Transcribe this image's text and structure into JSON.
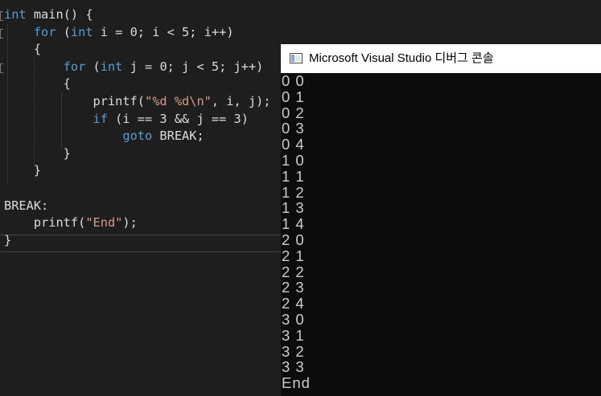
{
  "editor": {
    "lines": [
      {
        "parts": [
          {
            "t": "int",
            "c": "kw"
          },
          {
            "t": " main() {",
            "c": ""
          }
        ]
      },
      {
        "parts": [
          {
            "t": "    ",
            "c": ""
          },
          {
            "t": "for",
            "c": "kw"
          },
          {
            "t": " (",
            "c": ""
          },
          {
            "t": "int",
            "c": "kw"
          },
          {
            "t": " i = 0; i < 5; i++)",
            "c": ""
          }
        ]
      },
      {
        "parts": [
          {
            "t": "    {",
            "c": ""
          }
        ]
      },
      {
        "parts": [
          {
            "t": "        ",
            "c": ""
          },
          {
            "t": "for",
            "c": "kw"
          },
          {
            "t": " (",
            "c": ""
          },
          {
            "t": "int",
            "c": "kw"
          },
          {
            "t": " j = 0; j < 5; j++)",
            "c": ""
          }
        ]
      },
      {
        "parts": [
          {
            "t": "        {",
            "c": ""
          }
        ]
      },
      {
        "parts": [
          {
            "t": "            printf(",
            "c": ""
          },
          {
            "t": "\"%d %d\\n\"",
            "c": "str"
          },
          {
            "t": ", i, j);",
            "c": ""
          }
        ]
      },
      {
        "parts": [
          {
            "t": "            ",
            "c": ""
          },
          {
            "t": "if",
            "c": "kw"
          },
          {
            "t": " (i == 3 && j == 3)",
            "c": ""
          }
        ]
      },
      {
        "parts": [
          {
            "t": "                ",
            "c": ""
          },
          {
            "t": "goto",
            "c": "kw"
          },
          {
            "t": " BREAK;",
            "c": ""
          }
        ]
      },
      {
        "parts": [
          {
            "t": "        }",
            "c": ""
          }
        ]
      },
      {
        "parts": [
          {
            "t": "    }",
            "c": ""
          }
        ]
      },
      {
        "parts": [
          {
            "t": "",
            "c": ""
          }
        ]
      },
      {
        "parts": [
          {
            "t": "BREAK:",
            "c": ""
          }
        ]
      },
      {
        "parts": [
          {
            "t": "    printf(",
            "c": ""
          },
          {
            "t": "\"End\"",
            "c": "str"
          },
          {
            "t": ");",
            "c": ""
          }
        ]
      },
      {
        "parts": [
          {
            "t": "}",
            "c": ""
          }
        ]
      }
    ]
  },
  "console": {
    "title": "Microsoft Visual Studio 디버그 콘솔",
    "output": [
      "0 0",
      "0 1",
      "0 2",
      "0 3",
      "0 4",
      "1 0",
      "1 1",
      "1 2",
      "1 3",
      "1 4",
      "2 0",
      "2 1",
      "2 2",
      "2 3",
      "2 4",
      "3 0",
      "3 1",
      "3 2",
      "3 3",
      "End"
    ]
  },
  "colors": {
    "keyword": "#569cd6",
    "string": "#d69d85",
    "text": "#dcdcdc",
    "background": "#1e1e1e",
    "console_background": "#0c0c0c"
  }
}
